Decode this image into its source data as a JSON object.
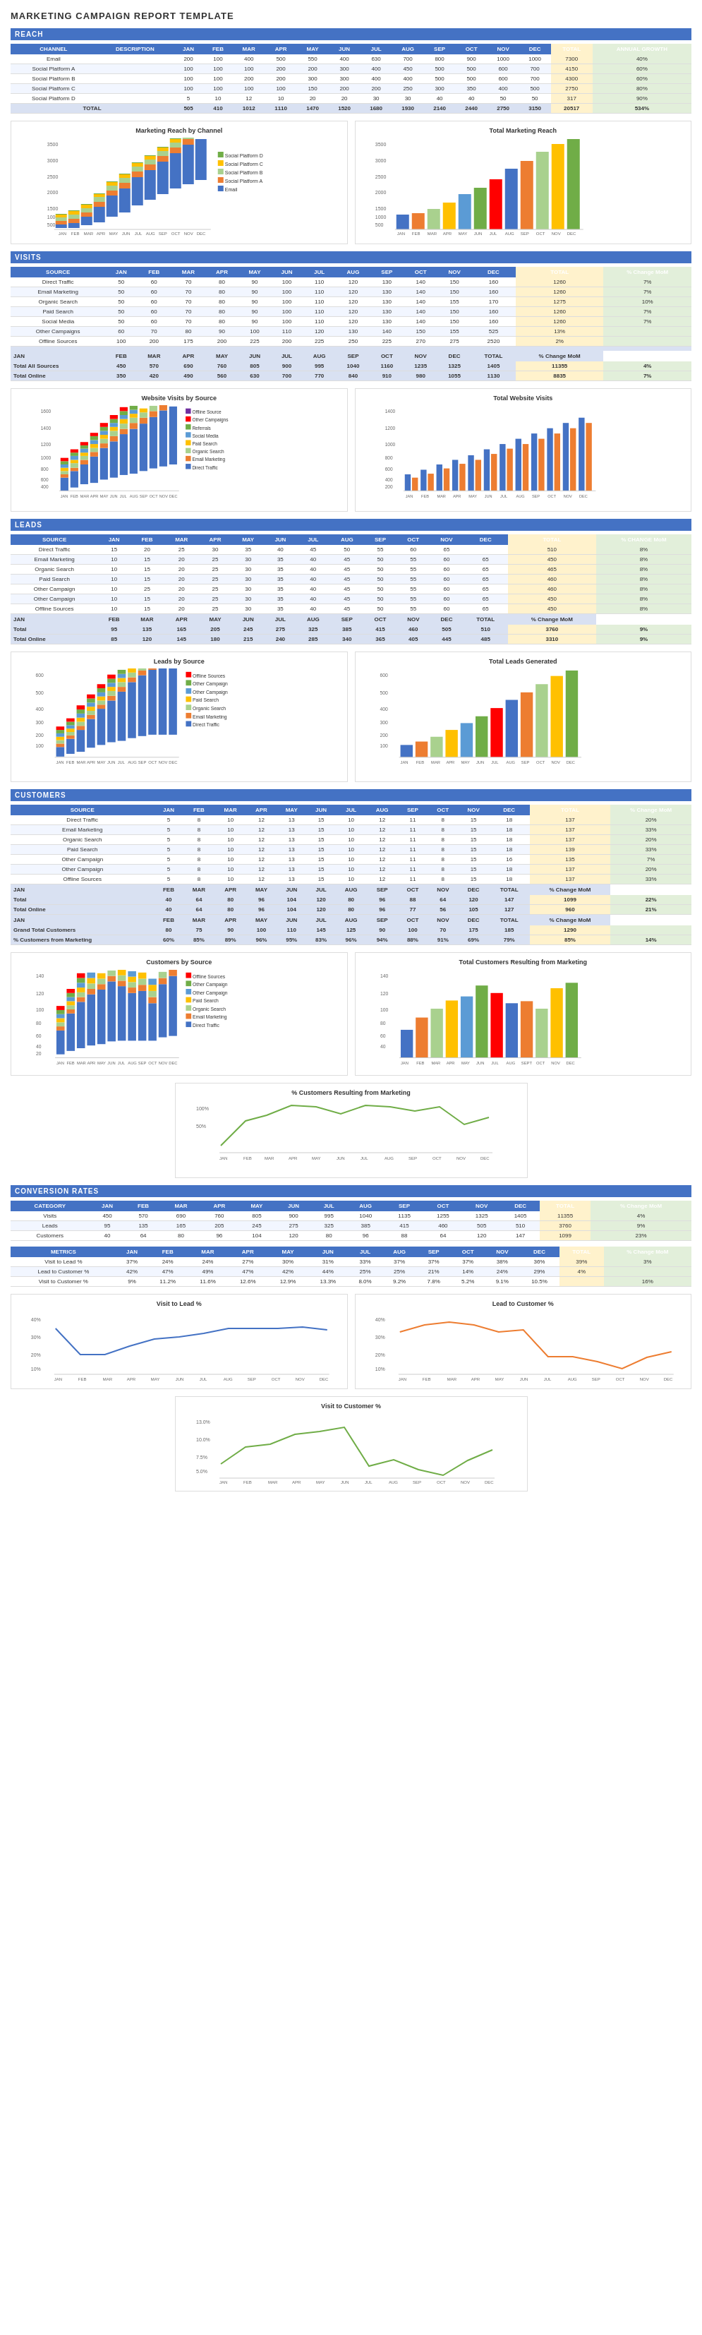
{
  "title": "MARKETING CAMPAIGN REPORT TEMPLATE",
  "sections": {
    "reach": {
      "label": "REACH",
      "headers": [
        "CHANNEL",
        "DESCRIPTION",
        "JAN",
        "FEB",
        "MAR",
        "APR",
        "MAY",
        "JUN",
        "JUL",
        "AUG",
        "SEP",
        "OCT",
        "NOV",
        "DEC",
        "TOTAL",
        "ANNUAL GROWTH"
      ],
      "rows": [
        [
          "Email",
          "",
          200,
          100,
          400,
          500,
          550,
          400,
          630,
          700,
          800,
          900,
          1000,
          1000,
          7300,
          "40%"
        ],
        [
          "Social Platform A",
          "",
          100,
          100,
          100,
          200,
          200,
          300,
          400,
          450,
          500,
          500,
          600,
          700,
          4150,
          "60%"
        ],
        [
          "Social Platform B",
          "",
          100,
          100,
          200,
          200,
          300,
          300,
          400,
          400,
          500,
          500,
          600,
          700,
          4300,
          "60%"
        ],
        [
          "Social Platform C",
          "",
          100,
          100,
          100,
          100,
          150,
          200,
          200,
          250,
          300,
          350,
          400,
          500,
          2750,
          "80%"
        ],
        [
          "Social Platform D",
          "",
          5,
          10,
          12,
          10,
          20,
          20,
          30,
          30,
          40,
          40,
          50,
          50,
          317,
          "90%"
        ]
      ],
      "total": [
        "TOTAL",
        "",
        505,
        410,
        1012,
        1110,
        1470,
        1520,
        1680,
        1930,
        2140,
        2440,
        2750,
        3150,
        20517,
        "534%"
      ]
    },
    "visits": {
      "label": "VISITS",
      "headers": [
        "SOURCE",
        "JAN",
        "FEB",
        "MAR",
        "APR",
        "MAY",
        "JUN",
        "JUL",
        "AUG",
        "SEP",
        "OCT",
        "NOV",
        "DEC",
        "TOTAL",
        "% Change MoM"
      ],
      "rows": [
        [
          "Direct Traffic",
          50,
          60,
          70,
          80,
          90,
          100,
          110,
          120,
          130,
          140,
          150,
          160,
          1260,
          "7%"
        ],
        [
          "Email Marketing",
          50,
          60,
          70,
          80,
          90,
          100,
          110,
          120,
          130,
          140,
          150,
          160,
          1260,
          "7%"
        ],
        [
          "Organic Search",
          50,
          60,
          70,
          80,
          90,
          100,
          110,
          120,
          130,
          140,
          155,
          170,
          1275,
          "10%"
        ],
        [
          "Paid Search",
          50,
          60,
          70,
          80,
          90,
          100,
          110,
          120,
          130,
          140,
          150,
          160,
          1260,
          "7%"
        ],
        [
          "Social Media",
          50,
          60,
          70,
          80,
          90,
          100,
          110,
          120,
          130,
          140,
          150,
          160,
          1260,
          "7%"
        ],
        [
          "Other Campaigns",
          60,
          70,
          80,
          90,
          100,
          110,
          120,
          130,
          140,
          150,
          155,
          525,
          "13%",
          ""
        ],
        [
          "Offline Sources",
          100,
          200,
          175,
          200,
          225,
          200,
          225,
          250,
          225,
          270,
          275,
          2520,
          "2%",
          ""
        ]
      ],
      "total_rows": [
        [
          "Total All Sources",
          450,
          570,
          690,
          760,
          805,
          900,
          995,
          1040,
          1160,
          1235,
          1325,
          1405,
          11355,
          "4%"
        ],
        [
          "Total Online",
          350,
          420,
          490,
          560,
          630,
          700,
          770,
          840,
          910,
          980,
          1055,
          1130,
          8835,
          "7%"
        ]
      ]
    },
    "leads": {
      "label": "LEADS",
      "headers": [
        "SOURCE",
        "JAN",
        "FEB",
        "MAR",
        "APR",
        "MAY",
        "JUN",
        "JUL",
        "AUG",
        "SEP",
        "OCT",
        "NOV",
        "DEC",
        "TOTAL",
        "% CHANGE MoM"
      ],
      "rows": [
        [
          "Direct Traffic",
          15,
          20,
          25,
          30,
          35,
          40,
          45,
          50,
          55,
          60,
          65,
          510,
          "8%",
          ""
        ],
        [
          "Email Marketing",
          10,
          15,
          20,
          25,
          30,
          35,
          40,
          45,
          50,
          55,
          60,
          65,
          450,
          "8%"
        ],
        [
          "Organic Search",
          10,
          15,
          20,
          25,
          30,
          35,
          40,
          45,
          50,
          55,
          60,
          65,
          465,
          "8%"
        ],
        [
          "Paid Search",
          10,
          15,
          20,
          25,
          30,
          35,
          40,
          45,
          50,
          55,
          60,
          65,
          460,
          "8%"
        ],
        [
          "Other Campaign",
          10,
          25,
          20,
          25,
          30,
          35,
          40,
          45,
          50,
          55,
          60,
          65,
          460,
          "8%"
        ],
        [
          "Other Campaign",
          10,
          15,
          20,
          25,
          30,
          35,
          40,
          45,
          50,
          55,
          60,
          65,
          450,
          "8%"
        ],
        [
          "Offline Sources",
          10,
          15,
          20,
          25,
          30,
          35,
          40,
          45,
          50,
          55,
          60,
          65,
          450,
          "8%"
        ]
      ],
      "total_rows": [
        [
          "Total",
          95,
          135,
          165,
          205,
          245,
          275,
          325,
          385,
          415,
          460,
          505,
          510,
          3760,
          "9%"
        ],
        [
          "Total Online",
          85,
          120,
          145,
          180,
          215,
          240,
          285,
          340,
          365,
          405,
          445,
          485,
          3310,
          "9%"
        ]
      ]
    },
    "customers": {
      "label": "CUSTOMERS",
      "headers": [
        "SOURCE",
        "JAN",
        "FEB",
        "MAR",
        "APR",
        "MAY",
        "JUN",
        "JUL",
        "AUG",
        "SEP",
        "OCT",
        "NOV",
        "DEC",
        "TOTAL",
        "% Change MoM"
      ],
      "rows": [
        [
          "Direct Traffic",
          5,
          8,
          10,
          12,
          13,
          15,
          10,
          12,
          11,
          8,
          15,
          18,
          137,
          "20%"
        ],
        [
          "Email Marketing",
          5,
          8,
          10,
          12,
          13,
          15,
          10,
          12,
          11,
          8,
          15,
          18,
          137,
          "33%"
        ],
        [
          "Organic Search",
          5,
          8,
          10,
          12,
          13,
          15,
          10,
          12,
          11,
          8,
          15,
          18,
          137,
          "20%"
        ],
        [
          "Paid Search",
          5,
          8,
          10,
          12,
          13,
          15,
          10,
          12,
          11,
          8,
          15,
          18,
          139,
          "33%"
        ],
        [
          "Other Campaign",
          5,
          8,
          10,
          12,
          13,
          15,
          10,
          12,
          11,
          8,
          15,
          16,
          135,
          "7%"
        ],
        [
          "Other Campaign",
          5,
          8,
          10,
          12,
          13,
          15,
          10,
          12,
          11,
          8,
          15,
          18,
          137,
          "20%"
        ],
        [
          "Offline Sources",
          5,
          8,
          10,
          12,
          13,
          15,
          10,
          12,
          11,
          8,
          15,
          18,
          137,
          "33%"
        ]
      ],
      "total_rows": [
        [
          "Total",
          40,
          64,
          80,
          96,
          104,
          120,
          80,
          96,
          88,
          64,
          120,
          147,
          1099,
          "22%"
        ],
        [
          "Total Online",
          40,
          64,
          80,
          96,
          104,
          120,
          80,
          96,
          77,
          56,
          105,
          127,
          960,
          "21%"
        ]
      ],
      "grand_rows": [
        [
          "Grand Total Customers",
          80,
          75,
          90,
          100,
          110,
          145,
          125,
          90,
          100,
          70,
          175,
          185,
          1290,
          ""
        ],
        [
          "% Customers from Marketing",
          "60%",
          "85%",
          "89%",
          "96%",
          "95%",
          "83%",
          "96%",
          "94%",
          "88%",
          "91%",
          "69%",
          "79%",
          "85%",
          "14%"
        ]
      ]
    },
    "conversion": {
      "label": "CONVERSION RATES",
      "cat_headers": [
        "CATEGORY",
        "JAN",
        "FEB",
        "MAR",
        "APR",
        "MAY",
        "JUN",
        "JUL",
        "AUG",
        "SEP",
        "SEPT",
        "OCT",
        "NOV",
        "DEC",
        "TOTAL",
        "% Change MoM"
      ],
      "cat_rows": [
        [
          "Visits",
          450,
          570,
          690,
          760,
          805,
          900,
          995,
          1040,
          1135,
          1255,
          1325,
          1405,
          11355,
          "4%"
        ],
        [
          "Leads",
          95,
          135,
          165,
          205,
          245,
          275,
          325,
          385,
          415,
          460,
          505,
          510,
          3760,
          "9%"
        ],
        [
          "Customers",
          40,
          64,
          80,
          96,
          104,
          120,
          80,
          96,
          88,
          64,
          120,
          147,
          1099,
          "23%"
        ]
      ],
      "met_headers": [
        "METRICS",
        "JAN",
        "FEB",
        "MAR",
        "APR",
        "MAY",
        "JUN",
        "JUL",
        "AUG",
        "SEP",
        "OCT",
        "NOV",
        "DEC",
        "TOTAL",
        "% Change MoM"
      ],
      "met_rows": [
        [
          "Visit to Lead %",
          "37%",
          "24%",
          "24%",
          "27%",
          "30%",
          "31%",
          "33%",
          "37%",
          "37%",
          "37%",
          "38%",
          "36%",
          "39%",
          "3%"
        ],
        [
          "Lead to Customer %",
          "42%",
          "47%",
          "49%",
          "47%",
          "42%",
          "44%",
          "25%",
          "25%",
          "21%",
          "14%",
          "24%",
          "29%",
          "4%",
          ""
        ],
        [
          "Visit to Customer %",
          "9%",
          "11.2%",
          "11.6%",
          "12.6%",
          "12.9%",
          "13.3%",
          "8.0%",
          "9.2%",
          "7.8%",
          "5.2%",
          "9.1%",
          "10.5%",
          "",
          "16%"
        ]
      ]
    }
  },
  "colors": {
    "email": "#4472c4",
    "platformA": "#ed7d31",
    "platformB": "#a9d18e",
    "platformC": "#ffc000",
    "platformD": "#70ad47",
    "direct": "#4472c4",
    "emailMkt": "#ed7d31",
    "organic": "#a9d18e",
    "paid": "#ffc000",
    "social": "#5b9bd5",
    "other1": "#70ad47",
    "other2": "#ff0000",
    "offline": "#7030a0",
    "header": "#4472c4",
    "totalRow": "#d9e1f2",
    "green": "#70ad47",
    "blue": "#4472c4",
    "orange": "#ed7d31",
    "yellow": "#ffc000"
  }
}
